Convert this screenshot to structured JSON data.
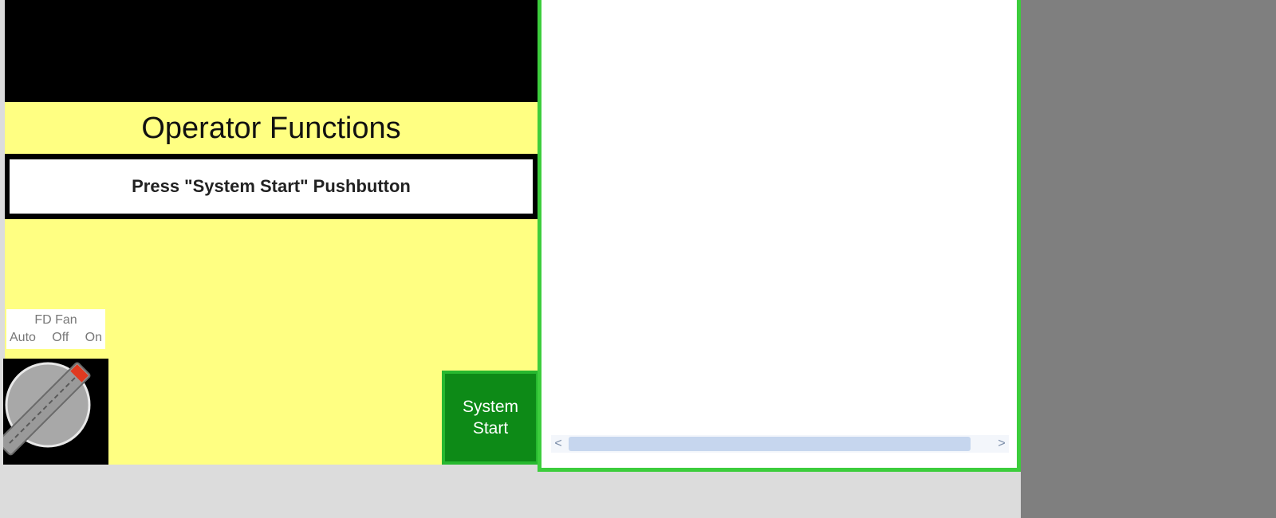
{
  "operator_panel": {
    "title": "Operator Functions",
    "message": "Press \"System Start\" Pushbutton"
  },
  "fd_fan": {
    "label": "FD Fan",
    "positions": [
      "Auto",
      "Off",
      "On"
    ]
  },
  "system_start": {
    "line1": "System",
    "line2": "Start"
  },
  "display_window": {
    "scroll_left": "<",
    "scroll_right": ">"
  },
  "colors": {
    "panel_yellow": "#ffff82",
    "start_green": "#0d8a17",
    "window_border": "#3ccd3c",
    "knob_indicator": "#e03a20"
  }
}
